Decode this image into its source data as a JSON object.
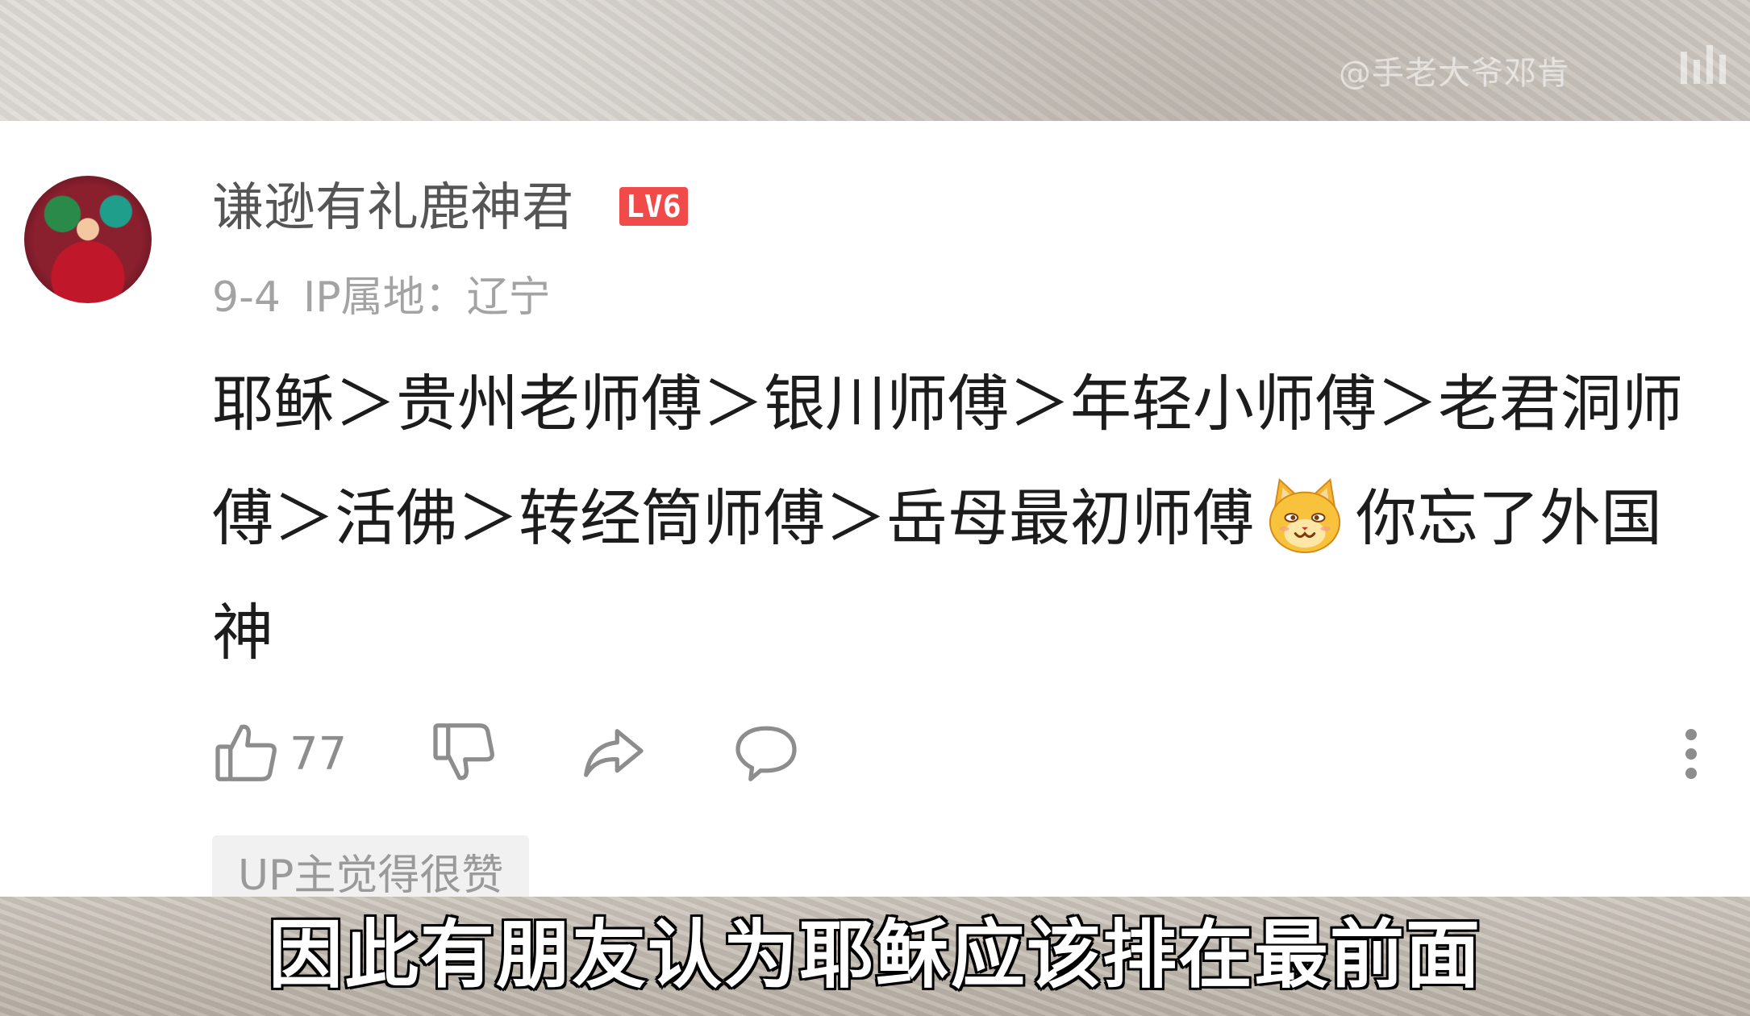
{
  "watermark": "@手老大爷邓肯",
  "comment": {
    "username": "谦逊有礼鹿神君",
    "level": "LV6",
    "date": "9-4",
    "ip_location": "IP属地：辽宁",
    "text_before_emoji": "耶稣＞贵州老师傅＞银川师傅＞年轻小师傅＞老君洞师傅＞活佛＞转经筒师傅＞岳母最初师傅",
    "text_after_emoji": "你忘了外国神",
    "emoji": "cat-smile-emoji"
  },
  "actions": {
    "like_count": "77",
    "icons": [
      "thumbs-up-icon",
      "thumbs-down-icon",
      "share-icon",
      "reply-icon",
      "more-icon"
    ]
  },
  "up_badge": "UP主觉得很赞",
  "subtitle": "因此有朋友认为耶稣应该排在最前面",
  "colors": {
    "card_bg": "#ffffff",
    "level_badge": "#f04a4a",
    "text_main": "#1c1c1c",
    "text_muted": "#a3a3a3"
  }
}
